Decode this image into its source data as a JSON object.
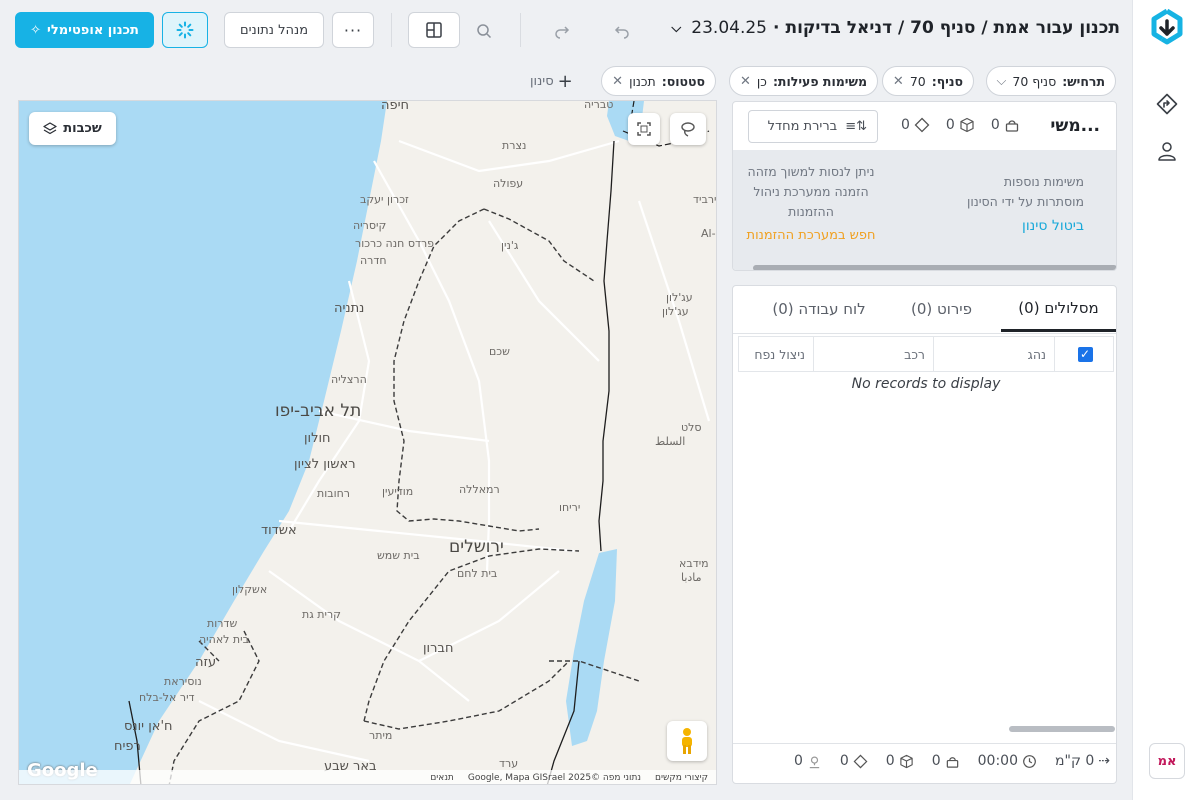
{
  "header": {
    "title_main": "תכנון עבור אמת / סניף 70 / דניאל בדיקות",
    "date": "23.04.25",
    "data_manager": "מנהל נתונים",
    "optimal_planning": "תכנון אופטימלי"
  },
  "filters": {
    "chips": [
      {
        "key": "תרחיש:",
        "value": "סניף 70",
        "kind": "dropdown"
      },
      {
        "key": "סניף:",
        "value": "70",
        "kind": "removable"
      },
      {
        "key": "משימות פעילות:",
        "value": "כן",
        "kind": "removable"
      },
      {
        "key": "סטטוס:",
        "value": "תכנון",
        "kind": "removable"
      }
    ],
    "add_filter": "סינון"
  },
  "map": {
    "layers_button": "שכבות",
    "attribution": "קיצורי מקשים",
    "data_credit": "נתוני מפה ©2025 Google, Mapa GISrael",
    "terms": "תנאים",
    "logo": "Google",
    "towns": [
      {
        "name": "חיפה",
        "size": "mid"
      },
      {
        "name": "טבריה",
        "size": "small"
      },
      {
        "name": "נצרת",
        "size": "small"
      },
      {
        "name": "עפולה",
        "size": "small"
      },
      {
        "name": "זכרון יעקב",
        "size": "small"
      },
      {
        "name": "קיסריה",
        "size": "small"
      },
      {
        "name": "פרדס חנה כרכור",
        "size": "small"
      },
      {
        "name": "חדרה",
        "size": "small"
      },
      {
        "name": "ג'נין",
        "size": "small"
      },
      {
        "name": "נתניה",
        "size": "mid"
      },
      {
        "name": "שכם",
        "size": "small"
      },
      {
        "name": "הרצליה",
        "size": "small"
      },
      {
        "name": "תל אביב-יפו",
        "size": "big"
      },
      {
        "name": "חולון",
        "size": "mid"
      },
      {
        "name": "ראשון לציון",
        "size": "mid"
      },
      {
        "name": "רחובות",
        "size": "small"
      },
      {
        "name": "מודיעין",
        "size": "small"
      },
      {
        "name": "רמאללה",
        "size": "small"
      },
      {
        "name": "יריחו",
        "size": "small"
      },
      {
        "name": "אשדוד",
        "size": "mid"
      },
      {
        "name": "ירושלים",
        "size": "big"
      },
      {
        "name": "בית שמש",
        "size": "small"
      },
      {
        "name": "בית לחם",
        "size": "small"
      },
      {
        "name": "אשקלון",
        "size": "small"
      },
      {
        "name": "קרית גת",
        "size": "small"
      },
      {
        "name": "שדרות",
        "size": "small"
      },
      {
        "name": "בית לאהיה",
        "size": "small"
      },
      {
        "name": "חברון",
        "size": "mid"
      },
      {
        "name": "עזה",
        "size": "mid"
      },
      {
        "name": "נוסיראת",
        "size": "small"
      },
      {
        "name": "דיר אל-בלח",
        "size": "small"
      },
      {
        "name": "ח'אן יונס",
        "size": "mid"
      },
      {
        "name": "רפיח",
        "size": "mid"
      },
      {
        "name": "מיתר",
        "size": "small"
      },
      {
        "name": "ערד",
        "size": "small"
      },
      {
        "name": "באר שבע",
        "size": "mid"
      },
      {
        "name": "עג'לון",
        "size": "small"
      },
      {
        "name": "עג'לון",
        "size": "small"
      },
      {
        "name": "סלט",
        "size": "small"
      },
      {
        "name": "السلط",
        "size": "small"
      },
      {
        "name": "מידבא",
        "size": "small"
      },
      {
        "name": "مادبا",
        "size": "small"
      },
      {
        "name": "אירביד",
        "size": "small"
      },
      {
        "name": "Al-I",
        "size": "small"
      }
    ]
  },
  "tasks_panel": {
    "title": "משי...",
    "count_a": "0",
    "count_b": "0",
    "count_c": "0",
    "default_select": "ברירת מחדל",
    "hidden_note_line1": "משימות נוספות",
    "hidden_note_line2": "מוסתרות על ידי הסינון",
    "cancel_filter": "ביטול סינון",
    "order_note_line1": "ניתן לנסות למשוך מזהה",
    "order_note_line2": "הזמנה ממערכת ניהול",
    "order_note_line3": "ההזמנות",
    "search_orders": "חפש במערכת ההזמנות"
  },
  "routes_panel": {
    "tabs": [
      "מסלולים (0)",
      "פירוט (0)",
      "לוח עבודה (0)"
    ],
    "columns": [
      "נהג",
      "רכב",
      "ניצול נפח"
    ],
    "empty": "No records to display",
    "footer": {
      "routes": "0",
      "distance": "0 ק\"מ",
      "time": "00:00",
      "weight": "0",
      "volume": "0",
      "tasks": "0",
      "stops": "0"
    }
  },
  "user": {
    "initials": "אמ"
  },
  "colors": {
    "accent": "#17b2e5",
    "warning_link": "#f0a020",
    "water": "#aadaf4"
  }
}
